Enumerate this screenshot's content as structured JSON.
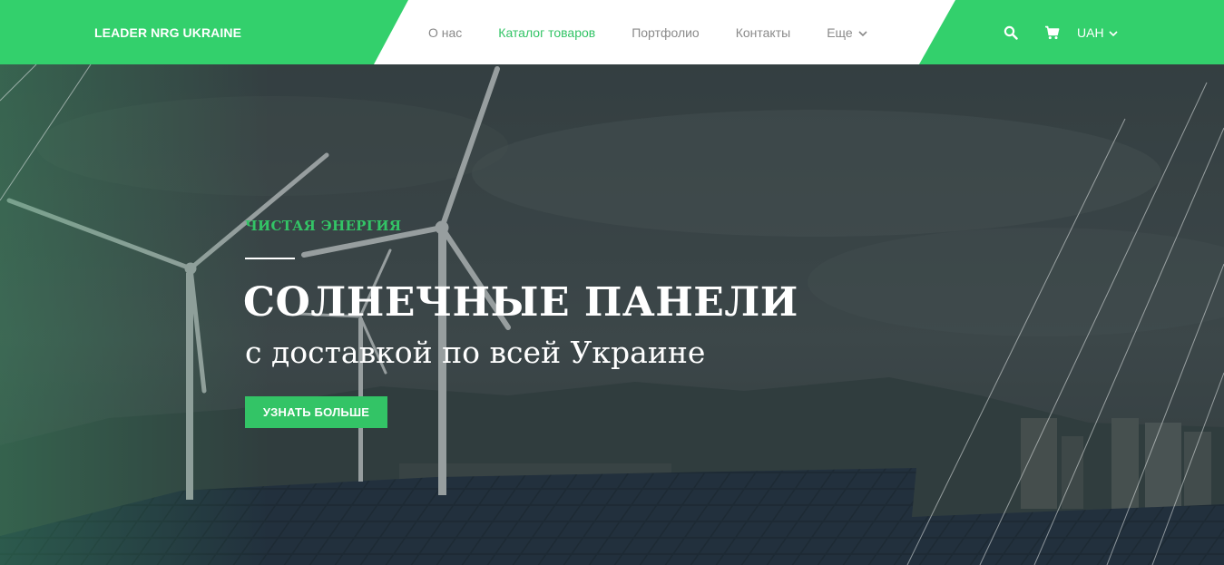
{
  "header": {
    "logo": "LEADER NRG UKRAINE",
    "nav": [
      {
        "label": "О нас",
        "active": false
      },
      {
        "label": "Каталог товаров",
        "active": true
      },
      {
        "label": "Портфолио",
        "active": false
      },
      {
        "label": "Контакты",
        "active": false
      },
      {
        "label": "Еще",
        "active": false,
        "has_dropdown": true
      }
    ],
    "tools": {
      "search_icon": "search-icon",
      "cart_icon": "cart-icon",
      "currency": "UAH"
    }
  },
  "hero": {
    "eyebrow": "ЧИСТАЯ ЭНЕРГИЯ",
    "headline": "СОЛНЕЧНЫЕ ПАНЕЛИ",
    "subline": "с доставкой по всей Украине",
    "cta_label": "УЗНАТЬ БОЛЬШЕ"
  },
  "colors": {
    "brand_green": "#33c466",
    "nav_text": "#8a8a8a",
    "hero_overlay": "#2b3a3f"
  }
}
